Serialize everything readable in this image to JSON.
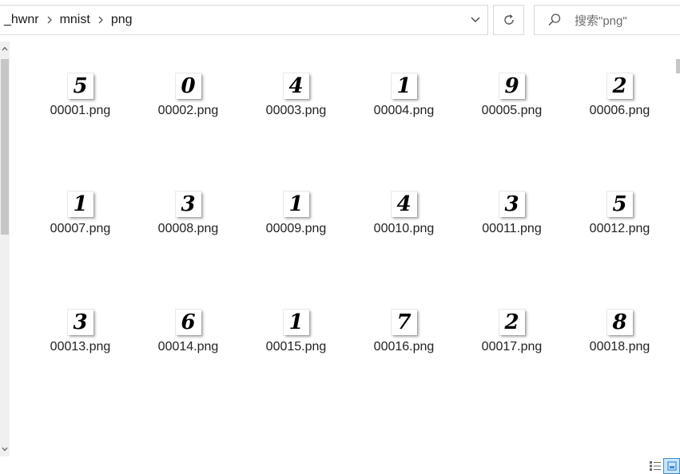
{
  "breadcrumb": {
    "items": [
      "_hwnr",
      "mnist",
      "png"
    ]
  },
  "search": {
    "placeholder": "搜索\"png\""
  },
  "files": [
    {
      "name": "00001.png",
      "digit": "5"
    },
    {
      "name": "00002.png",
      "digit": "0"
    },
    {
      "name": "00003.png",
      "digit": "4"
    },
    {
      "name": "00004.png",
      "digit": "1"
    },
    {
      "name": "00005.png",
      "digit": "9"
    },
    {
      "name": "00006.png",
      "digit": "2"
    },
    {
      "name": "00007.png",
      "digit": "1"
    },
    {
      "name": "00008.png",
      "digit": "3"
    },
    {
      "name": "00009.png",
      "digit": "1"
    },
    {
      "name": "00010.png",
      "digit": "4"
    },
    {
      "name": "00011.png",
      "digit": "3"
    },
    {
      "name": "00012.png",
      "digit": "5"
    },
    {
      "name": "00013.png",
      "digit": "3"
    },
    {
      "name": "00014.png",
      "digit": "6"
    },
    {
      "name": "00015.png",
      "digit": "1"
    },
    {
      "name": "00016.png",
      "digit": "7"
    },
    {
      "name": "00017.png",
      "digit": "2"
    },
    {
      "name": "00018.png",
      "digit": "8"
    }
  ],
  "view": {
    "icons": [
      "details-view-icon",
      "large-icons-view-icon"
    ],
    "active": "large-icons-view-icon",
    "accent": "#3d8fd6"
  }
}
